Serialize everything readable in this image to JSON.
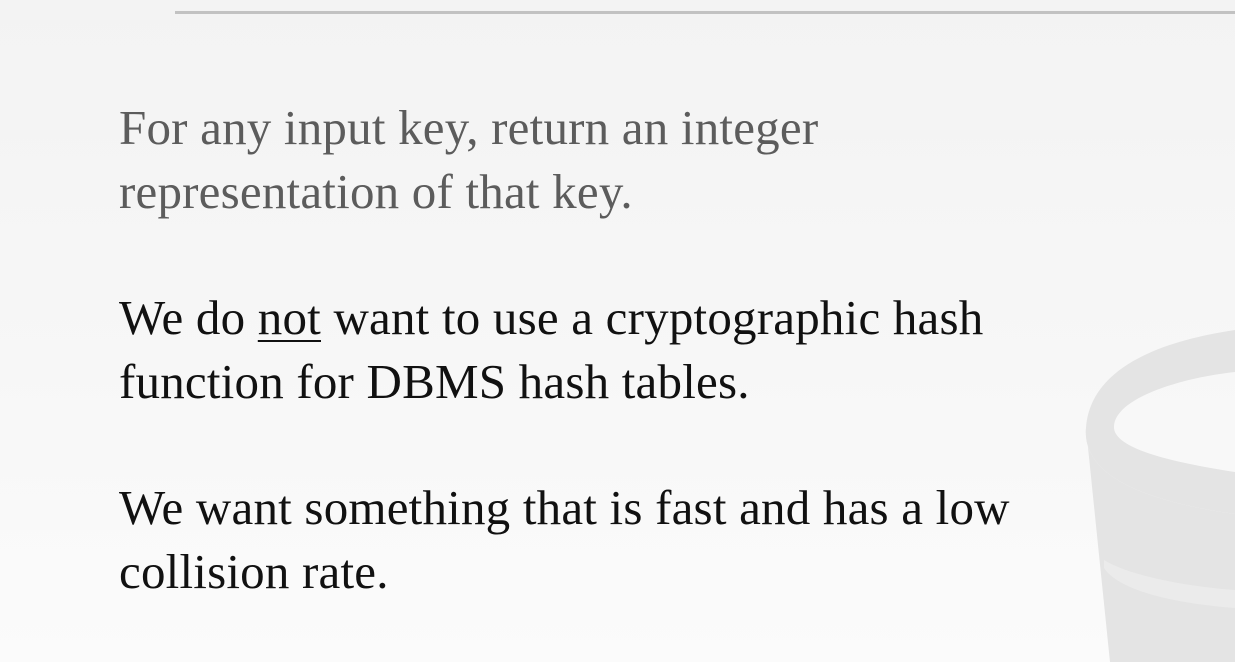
{
  "slide": {
    "paragraph_1": {
      "line_1": "For any input key, return an integer",
      "line_2": "representation of that key."
    },
    "paragraph_2": {
      "line_1_before": "We do ",
      "line_1_emphasis": "not",
      "line_1_after": " want to use a cryptographic hash",
      "line_2": "function for DBMS hash tables."
    },
    "paragraph_3": {
      "line_1": "We want something that is fast and has a low",
      "line_2": "collision rate."
    }
  },
  "colors": {
    "background": "#f5f5f5",
    "rule": "#c2c2c2",
    "muted_text": "#5c5c5c",
    "body_text": "#111111",
    "watermark": "#e4e4e4"
  },
  "decorations": {
    "watermark_icon": "database-icon"
  }
}
